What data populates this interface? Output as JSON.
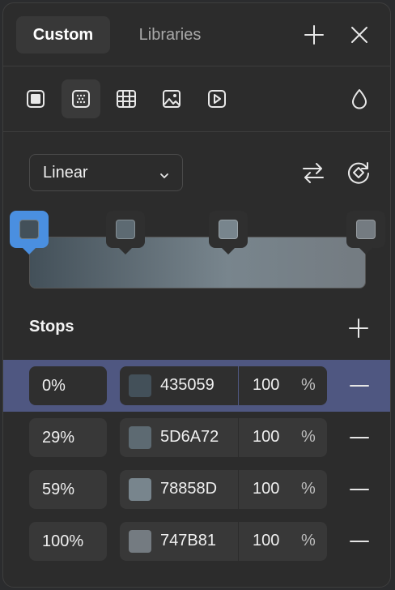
{
  "header": {
    "tabs": [
      {
        "label": "Custom",
        "active": true
      },
      {
        "label": "Libraries",
        "active": false
      }
    ],
    "add_icon": "plus-icon",
    "close_icon": "close-icon"
  },
  "fill_types": [
    {
      "name": "solid",
      "icon": "solid-fill-icon",
      "active": false
    },
    {
      "name": "gradient",
      "icon": "gradient-fill-icon",
      "active": true
    },
    {
      "name": "pattern",
      "icon": "pattern-fill-icon",
      "active": false
    },
    {
      "name": "image",
      "icon": "image-fill-icon",
      "active": false
    },
    {
      "name": "video",
      "icon": "video-fill-icon",
      "active": false
    }
  ],
  "opacity_icon": "droplet-icon",
  "gradient": {
    "type_label": "Linear",
    "swap_icon": "swap-arrows-icon",
    "rotate_icon": "rotate-icon",
    "colors": {
      "start": "#435059",
      "mid": "#78858D",
      "end": "#747B81",
      "selected_handle": "#4a8fe0"
    }
  },
  "stops": {
    "title": "Stops",
    "add_icon": "plus-icon",
    "percent_symbol": "%",
    "items": [
      {
        "position": "0%",
        "hex": "435059",
        "color": "#435059",
        "opacity": "100",
        "selected": true
      },
      {
        "position": "29%",
        "hex": "5D6A72",
        "color": "#5D6A72",
        "opacity": "100",
        "selected": false
      },
      {
        "position": "59%",
        "hex": "78858D",
        "color": "#78858D",
        "opacity": "100",
        "selected": false
      },
      {
        "position": "100%",
        "hex": "747B81",
        "color": "#747B81",
        "opacity": "100",
        "selected": false
      }
    ]
  }
}
